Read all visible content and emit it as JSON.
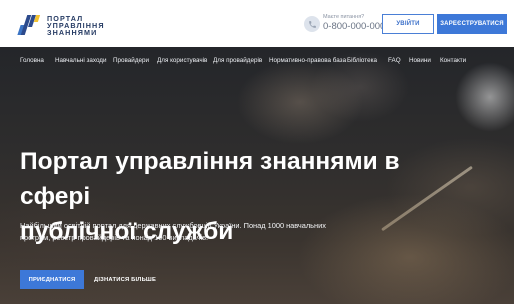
{
  "header": {
    "logo_lines": [
      "ПОРТАЛ",
      "УПРАВЛІННЯ",
      "ЗНАННЯМИ"
    ],
    "phone_question": "Маєте питання?",
    "phone_number": "0-800-000-000",
    "login_label": "УВІЙТИ",
    "register_label": "ЗАРЕЄСТРУВАТИСЯ"
  },
  "nav": {
    "items": [
      "Головна",
      "Навчальні заходи",
      "Провайдери",
      "Для користувачів",
      "Для провайдерів",
      "Нормативно-правова база",
      "Бібліотека",
      "FAQ",
      "Новини",
      "Контакти"
    ]
  },
  "hero": {
    "title_line1": "Портал управління знаннями в сфері",
    "title_line2": "публічної служби",
    "subtitle_line1": "Найбільший освітній портал для державних службовців України. Понад 1000 навчальних",
    "subtitle_line2": "програм, реєстр провайдерів та понад 100 викладачів.",
    "join_label": "ПРИЄДНАТИСЯ",
    "more_label": "ДІЗНАТИСЯ БІЛЬШЕ"
  },
  "colors": {
    "accent": "#3d78d8",
    "logo_dark": "#253a63",
    "logo_yellow": "#f2c230"
  },
  "icons": {
    "logo": "portal-logo-icon",
    "phone": "phone-icon"
  }
}
